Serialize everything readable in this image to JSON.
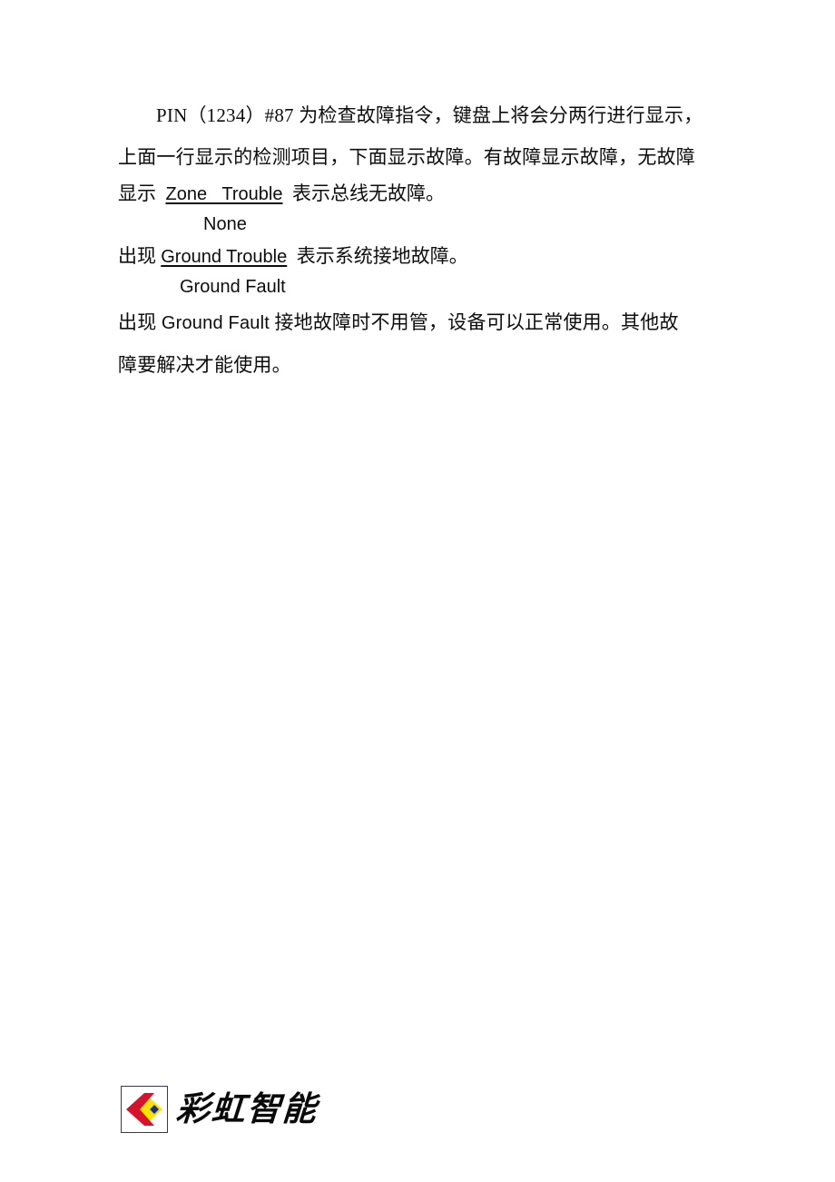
{
  "document": {
    "background_color": "#ffffff",
    "text_color": "#0d0d0d",
    "paragraphs": {
      "p1_line1_prefix": "PIN（1234）#87 ",
      "p1_line1_rest": "为检查故障指令，键盘上将会分两行进行显示，",
      "p1_line2": "上面一行显示的检测项目，下面显示故障。有故障显示故障，无故障",
      "p3_prefix": "出现 ",
      "p3_term": "Ground Fault",
      "p3_rest": " 接地故障时不用管，设备可以正常使用。其他故",
      "p3_line2": "障要解决才能使用。"
    },
    "display_blocks": [
      {
        "lead": "显示  ",
        "term": "Zone   Trouble",
        "trail": "  表示总线无故障。",
        "sub": "None"
      },
      {
        "lead": "出现 ",
        "term": "Ground Trouble",
        "trail": "  表示系统接地故障。",
        "sub": "Ground Fault"
      }
    ]
  },
  "logo": {
    "brand_text": "彩虹智能",
    "mark": {
      "name": "rainbow-chevron-mark",
      "border_color": "#3a3a4a",
      "chevron_color": "#d7122a",
      "diamond_color": "#f5e400",
      "accent_color": "#1b2a8c",
      "background_color": "#ffffff"
    }
  }
}
